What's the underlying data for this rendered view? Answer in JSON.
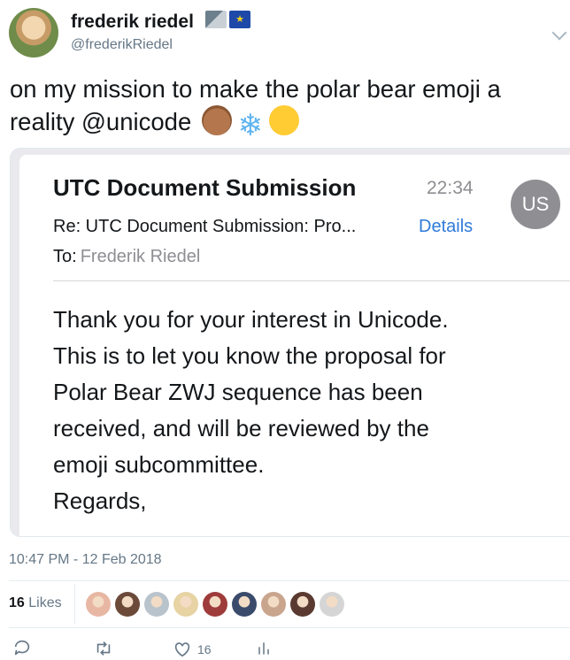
{
  "profile": {
    "name": "frederik riedel",
    "handle": "@frederikRiedel",
    "flags": [
      "saxony-flag-icon",
      "eu-flag-icon"
    ]
  },
  "tweet": {
    "text": "on my mission to make the polar bear emoji a reality @unicode",
    "emojis": [
      "bear-emoji",
      "snowflake-emoji",
      "heart-eyes-emoji"
    ],
    "timestamp": "10:47 PM - 12 Feb 2018"
  },
  "email": {
    "sender": "UTC Document Submission",
    "time": "22:34",
    "avatar_initials": "US",
    "subject_line": "Re: UTC Document Submission: Pro...",
    "details_label": "Details",
    "to_label": "To:",
    "to_name": "Frederik Riedel",
    "body_lines": [
      "Thank you for your interest in Unicode.",
      "This is to let you know the proposal for",
      "Polar Bear ZWJ sequence has been",
      "received, and will be reviewed by the",
      "emoji subcommittee.",
      "Regards,"
    ]
  },
  "engagement": {
    "likes_count": "16",
    "likes_label": "Likes",
    "like_action_count": "16",
    "liker_avatars": [
      "#e8b7a4",
      "#6b4a3a",
      "#b9c3cc",
      "#e7d3a3",
      "#9e3b3b",
      "#3a4b6b",
      "#c9a58d",
      "#5a3a30",
      "#d5d5d5"
    ]
  },
  "colors": {
    "accent": "#2f7bd9",
    "muted": "#657786",
    "avatar_gray": "#8e8e93"
  }
}
